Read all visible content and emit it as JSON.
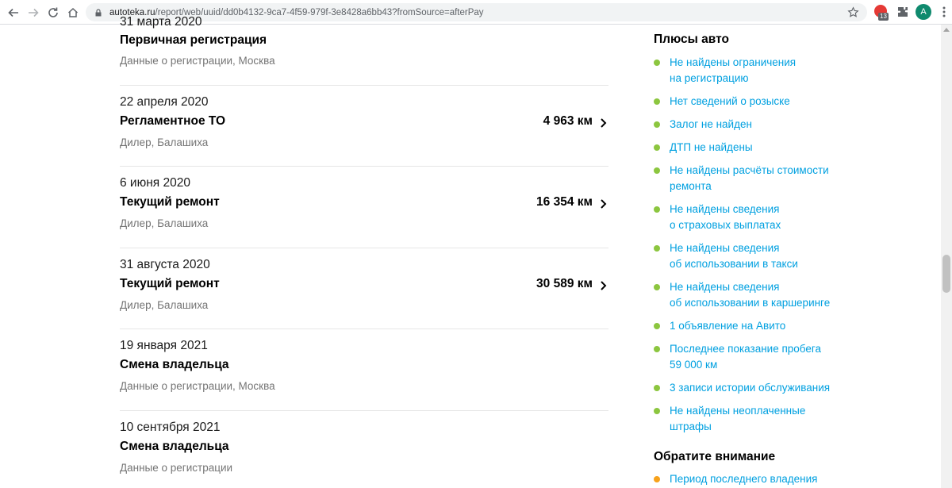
{
  "browser": {
    "url_host": "autoteka.ru",
    "url_path": "/report/web/uuid/dd0b4132-9ca7-4f59-979f-3e8428a6bb43?fromSource=afterPay",
    "extension_badge": "13",
    "avatar_letter": "A"
  },
  "timeline": {
    "events": [
      {
        "date": "31 марта 2020",
        "title": "Первичная регистрация",
        "place": "Данные о регистрации, Москва",
        "mileage": ""
      },
      {
        "date": "22 апреля 2020",
        "title": "Регламентное ТО",
        "place": "Дилер, Балашиха",
        "mileage": "4 963 км"
      },
      {
        "date": "6 июня 2020",
        "title": "Текущий ремонт",
        "place": "Дилер, Балашиха",
        "mileage": "16 354 км"
      },
      {
        "date": "31 августа 2020",
        "title": "Текущий ремонт",
        "place": "Дилер, Балашиха",
        "mileage": "30 589 км"
      },
      {
        "date": "19 января 2021",
        "title": "Смена владельца",
        "place": "Данные о регистрации, Москва",
        "mileage": ""
      },
      {
        "date": "10 сентября 2021",
        "title": "Смена владельца",
        "place": "Данные о регистрации",
        "mileage": ""
      }
    ]
  },
  "sidebar": {
    "pros_heading": "Плюсы авто",
    "pros": [
      {
        "line1": "Не найдены ограничения",
        "line2": "на регистрацию"
      },
      {
        "line1": "Нет сведений о розыске",
        "line2": ""
      },
      {
        "line1": "Залог не найден",
        "line2": ""
      },
      {
        "line1": "ДТП не найдены",
        "line2": ""
      },
      {
        "line1": "Не найдены расчёты стоимости",
        "line2": "ремонта"
      },
      {
        "line1": "Не найдены сведения",
        "line2": "о страховых выплатах"
      },
      {
        "line1": "Не найдены сведения",
        "line2": "об использовании в такси"
      },
      {
        "line1": "Не найдены сведения",
        "line2": "об использовании в каршеринге"
      },
      {
        "line1": "1 объявление на Авито",
        "line2": ""
      },
      {
        "line1": "Последнее показание пробега",
        "line2": "59 000 км"
      },
      {
        "line1": "3 записи истории обслуживания",
        "line2": ""
      },
      {
        "line1": "Не найдены неоплаченные",
        "line2": "штрафы"
      }
    ],
    "attention_heading": "Обратите внимание",
    "attention": [
      {
        "line1": "Период последнего владения",
        "line2": ""
      }
    ]
  },
  "colors": {
    "link_blue": "#00a0e0",
    "dot_green": "#8cc63f",
    "dot_orange": "#f7a21b"
  }
}
